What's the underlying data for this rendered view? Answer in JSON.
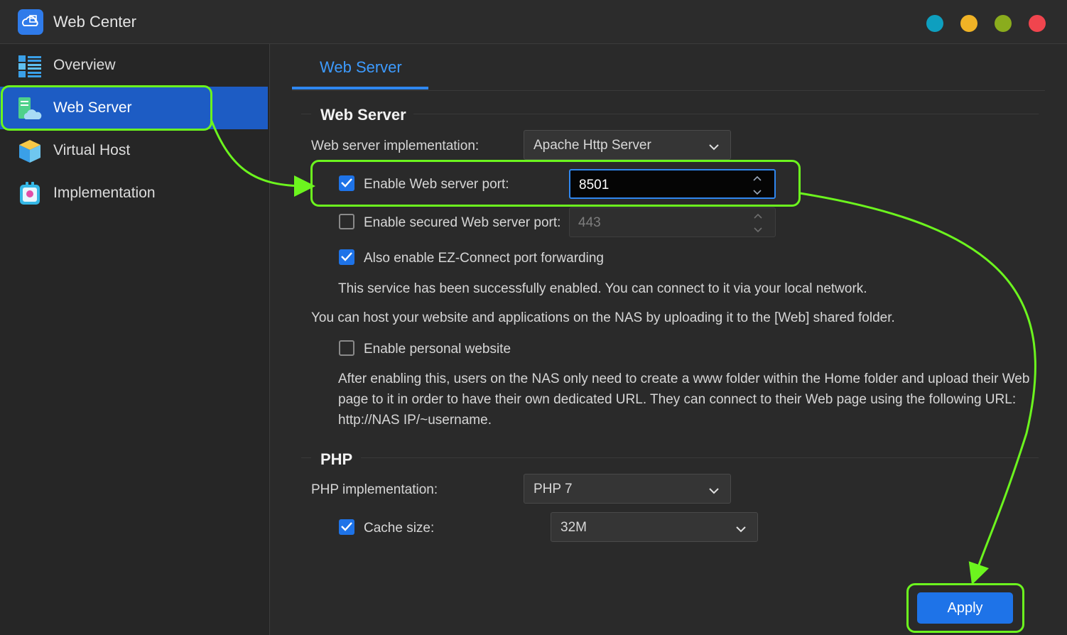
{
  "window": {
    "title": "Web Center",
    "buttons": [
      {
        "name": "window-teal-button",
        "color": "#0e9fbf"
      },
      {
        "name": "window-yellow-button",
        "color": "#f0b326"
      },
      {
        "name": "window-green-button",
        "color": "#8aac1d"
      },
      {
        "name": "window-red-button",
        "color": "#f0454e"
      }
    ]
  },
  "sidebar": {
    "items": [
      {
        "label": "Overview",
        "icon": "overview-icon"
      },
      {
        "label": "Web Server",
        "icon": "web-server-icon",
        "active": true
      },
      {
        "label": "Virtual Host",
        "icon": "virtual-host-icon"
      },
      {
        "label": "Implementation",
        "icon": "implementation-icon"
      }
    ]
  },
  "tabs": [
    {
      "label": "Web Server",
      "active": true
    }
  ],
  "web_server": {
    "section_title": "Web Server",
    "implementation_label": "Web server implementation:",
    "implementation_value": "Apache Http Server",
    "port_label": "Enable Web server port:",
    "port_checked": true,
    "port_value": "8501",
    "secure_port_label": "Enable secured Web server port:",
    "secure_port_checked": false,
    "secure_port_value": "443",
    "ez_connect_label": "Also enable EZ-Connect port forwarding",
    "ez_connect_checked": true,
    "status_text": "This service has been successfully enabled. You can connect to it via your local network.",
    "host_info": "You can host your website and applications on the NAS by uploading it to the [Web] shared folder.",
    "personal_label": "Enable personal website",
    "personal_checked": false,
    "personal_desc": "After enabling this, users on the NAS only need to create a www folder within the Home folder and upload their Web page to it in order to have their own dedicated URL. They can connect to their Web page using the following URL: http://NAS IP/~username."
  },
  "php": {
    "section_title": "PHP",
    "implementation_label": "PHP implementation:",
    "implementation_value": "PHP 7",
    "cache_label": "Cache size:",
    "cache_checked": true,
    "cache_value": "32M"
  },
  "footer": {
    "apply_label": "Apply"
  },
  "colors": {
    "accent": "#1e73e8",
    "highlight": "#6cf51e",
    "tab": "#3d9bff"
  }
}
